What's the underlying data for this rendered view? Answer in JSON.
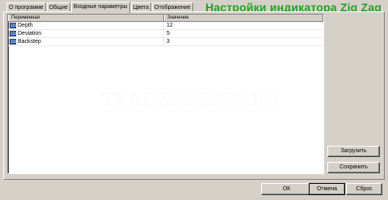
{
  "tabs": [
    {
      "label": "О программе"
    },
    {
      "label": "Общие"
    },
    {
      "label": "Входные параметры"
    },
    {
      "label": "Цвета"
    },
    {
      "label": "Отображение"
    }
  ],
  "active_tab": "Входные параметры",
  "heading": "Настройки индикатора Zig Zag",
  "heading_color": "#1aa61a",
  "grid": {
    "columns": [
      "Переменная",
      "Значение"
    ],
    "rows": [
      {
        "icon": "int-param-icon",
        "icon_text": "123",
        "name": "Depth",
        "value": "12"
      },
      {
        "icon": "int-param-icon",
        "icon_text": "123",
        "name": "Deviation",
        "value": "5"
      },
      {
        "icon": "int-param-icon",
        "icon_text": "123",
        "name": "Backstep",
        "value": "3"
      }
    ]
  },
  "watermark": "TRADEXPERTS.RU",
  "side_buttons": {
    "load": "Загрузить",
    "save": "Сохранить"
  },
  "footer_buttons": {
    "ok": "ОК",
    "cancel": "Отмена",
    "reset": "Сброс"
  }
}
